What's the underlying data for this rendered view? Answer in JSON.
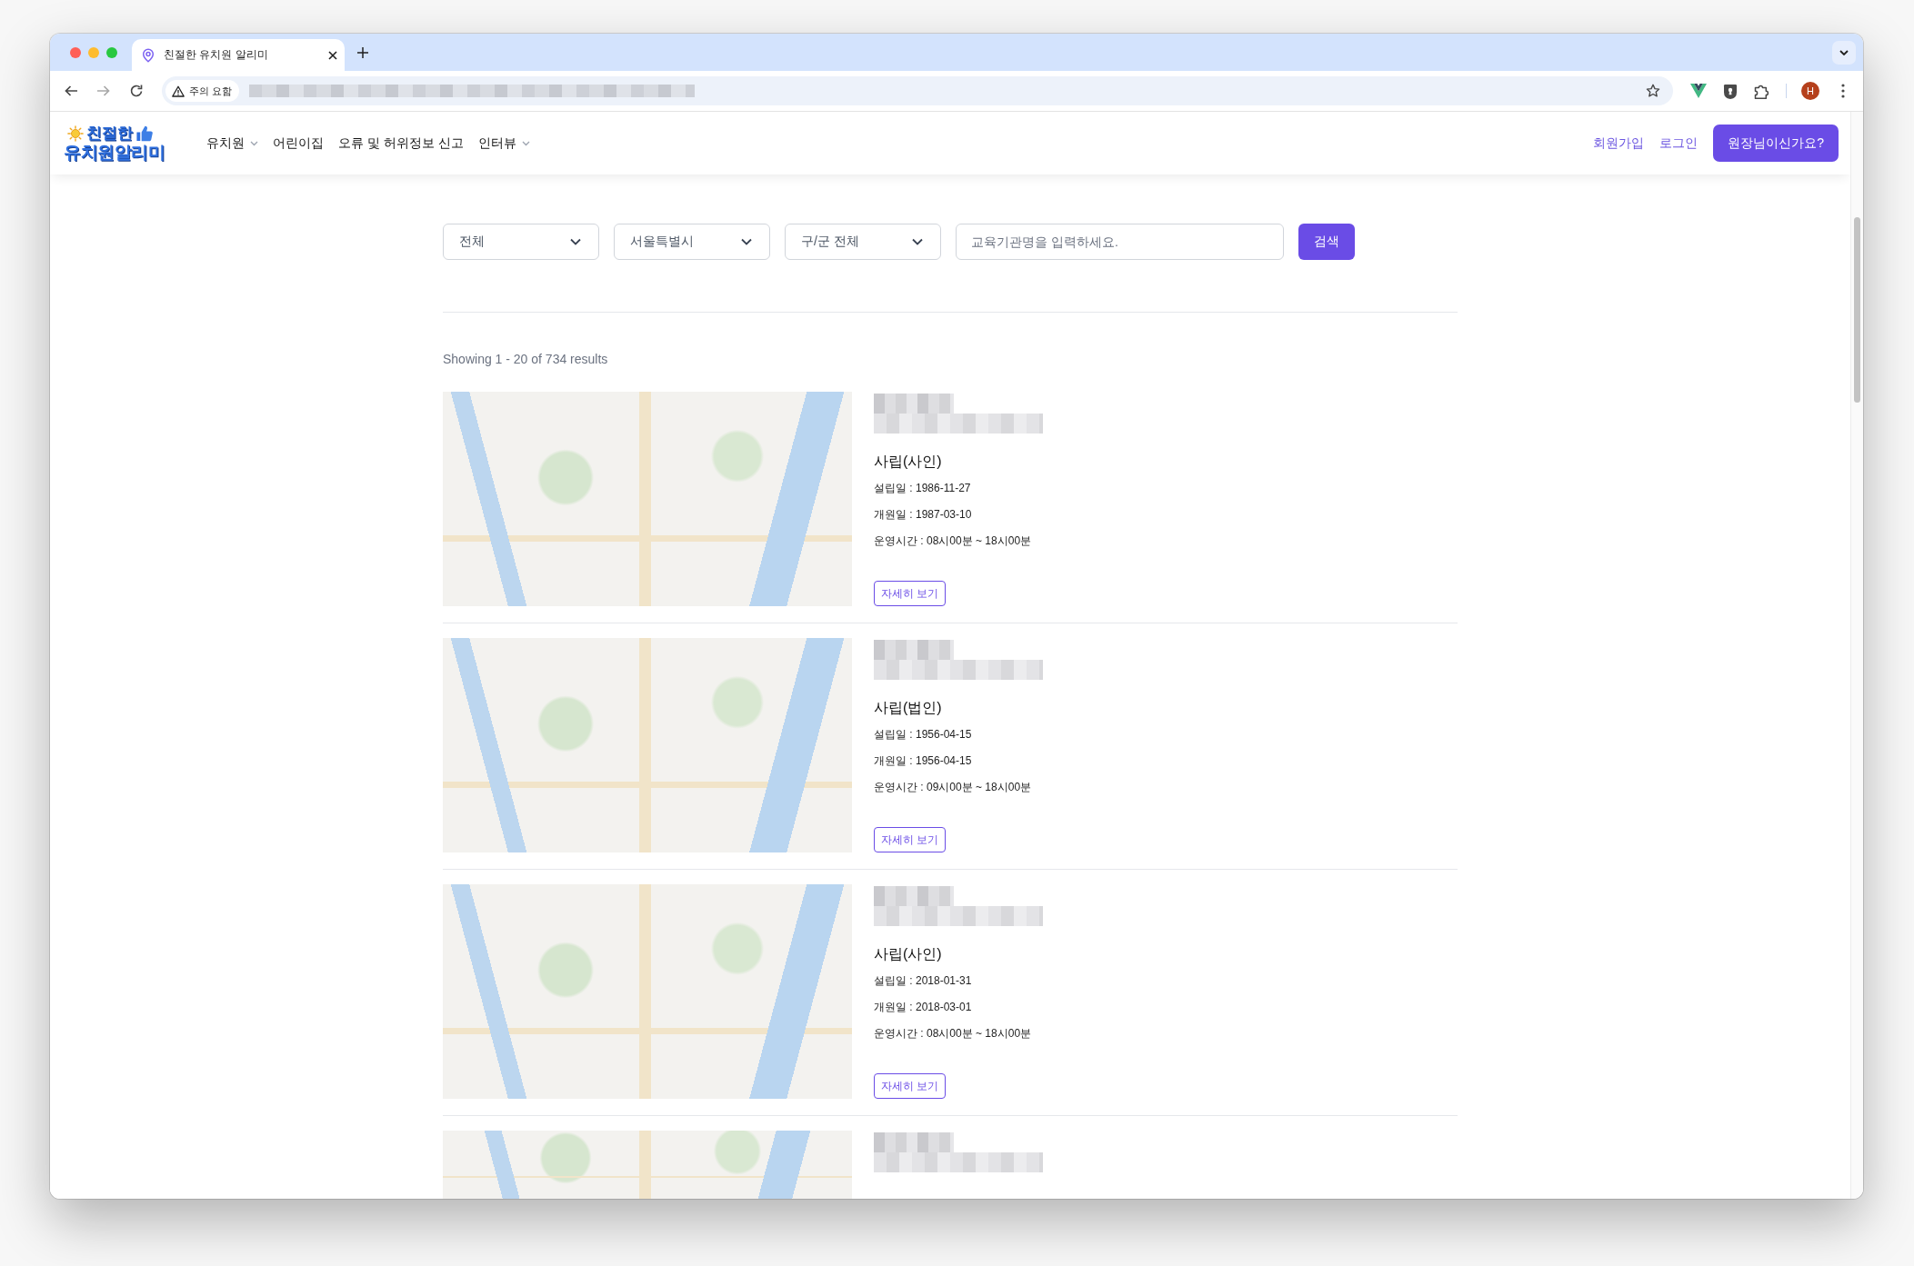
{
  "browser": {
    "tab": {
      "title": "친절한 유치원 알리미"
    },
    "security_label": "주의 요함",
    "profile_initial": "H"
  },
  "navbar": {
    "logo": {
      "line_1": "친절한",
      "line_2": "유치원알리미"
    },
    "menu": [
      {
        "label": "유치원",
        "dropdown": true
      },
      {
        "label": "어린이집",
        "dropdown": false
      },
      {
        "label": "오류 및 허위정보 신고",
        "dropdown": false
      },
      {
        "label": "인터뷰",
        "dropdown": true
      }
    ],
    "links": [
      "회원가입",
      "로그인"
    ],
    "cta_button": "원장님이신가요?"
  },
  "search": {
    "filters": [
      "전체",
      "서울특별시",
      "구/군 전체"
    ],
    "keyword": {
      "placeholder": "교육기관명을 입력하세요."
    },
    "button": "검색"
  },
  "results": {
    "summary": "Showing 1 - 20 of 734 results",
    "items": [
      {
        "kind": "full",
        "type": "사립(사인)",
        "founded": "설립일 : 1986-11-27",
        "opened": "개원일 : 1987-03-10",
        "hours": "운영시간 : 08시00분 ~ 18시00분",
        "button": "자세히 보기"
      },
      {
        "kind": "full",
        "type": "사립(법인)",
        "founded": "설립일 : 1956-04-15",
        "opened": "개원일 : 1956-04-15",
        "hours": "운영시간 : 09시00분 ~ 18시00분",
        "button": "자세히 보기"
      },
      {
        "kind": "full",
        "type": "사립(사인)",
        "founded": "설립일 : 2018-01-31",
        "opened": "개원일 : 2018-03-01",
        "hours": "운영시간 : 08시00분 ~ 18시00분",
        "button": "자세히 보기"
      },
      {
        "kind": "partial"
      }
    ]
  }
}
